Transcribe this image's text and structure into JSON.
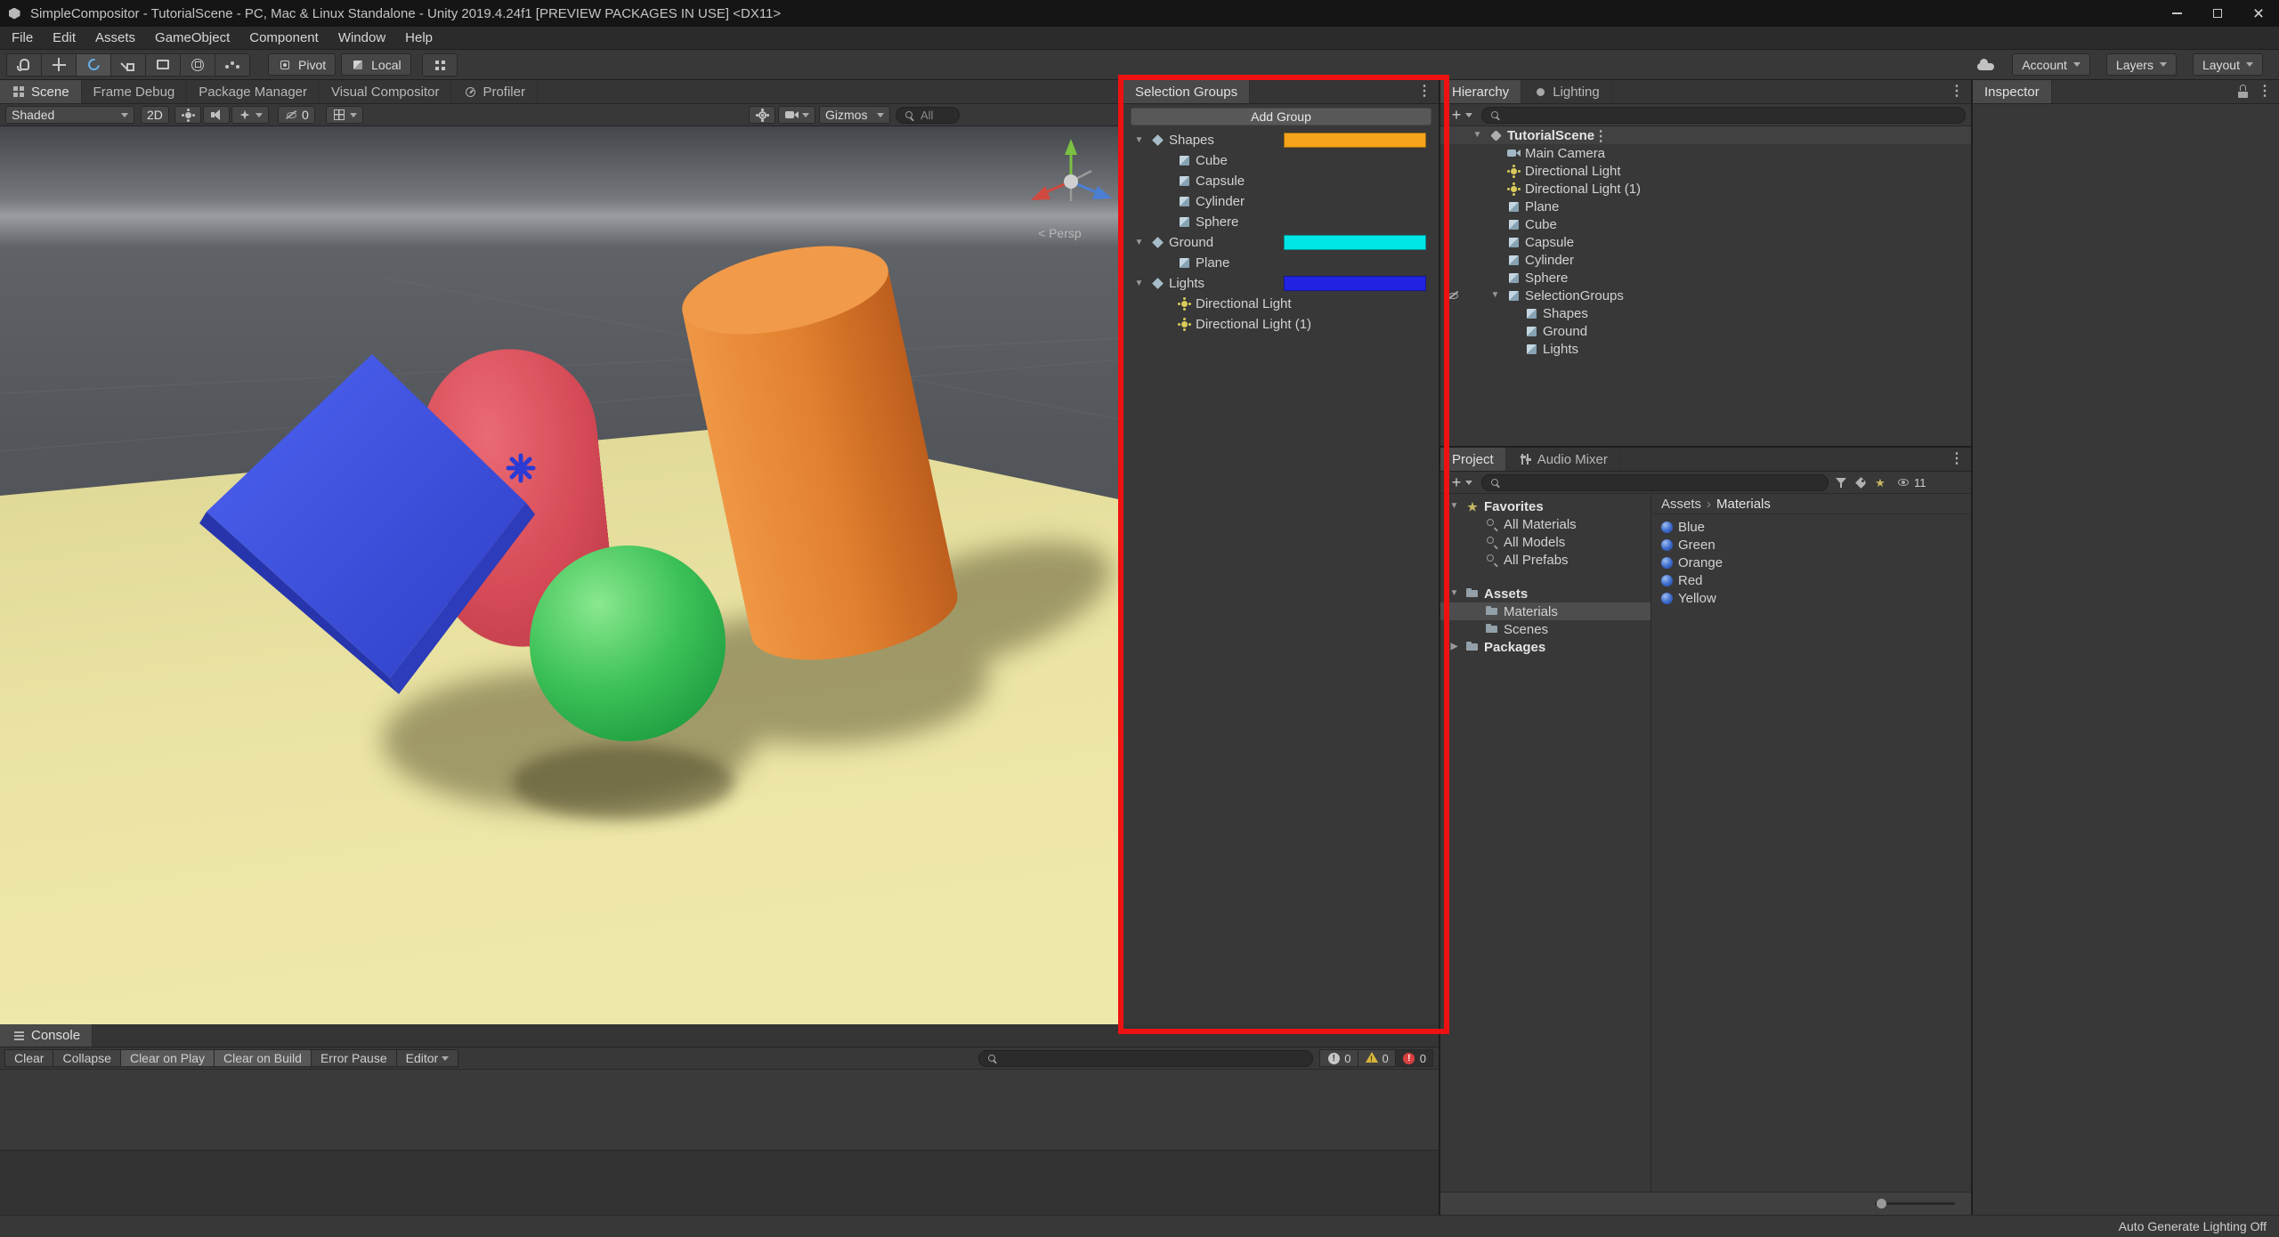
{
  "window": {
    "title": "SimpleCompositor - TutorialScene - PC, Mac & Linux Standalone - Unity 2019.4.24f1 [PREVIEW PACKAGES IN USE] <DX11>"
  },
  "menu": {
    "items": [
      "File",
      "Edit",
      "Assets",
      "GameObject",
      "Component",
      "Window",
      "Help"
    ]
  },
  "toolbar": {
    "tools": [
      {
        "icon": "hand-tool-icon"
      },
      {
        "icon": "move-tool-icon"
      },
      {
        "icon": "rotate-tool-icon",
        "active": true
      },
      {
        "icon": "scale-tool-icon"
      },
      {
        "icon": "rect-tool-icon"
      },
      {
        "icon": "transform-tool-icon"
      },
      {
        "icon": "custom-tool-icon"
      }
    ],
    "pivot": "Pivot",
    "local": "Local",
    "account": "Account",
    "layers": "Layers",
    "layout": "Layout"
  },
  "scene": {
    "tabs": [
      {
        "label": "Scene",
        "icon": "scene-tab-icon",
        "active": true
      },
      {
        "label": "Frame Debug"
      },
      {
        "label": "Package Manager"
      },
      {
        "label": "Visual Compositor"
      },
      {
        "label": "Profiler",
        "icon": "profiler-icon"
      }
    ],
    "controls": {
      "shaded": "Shaded",
      "two_d": "2D",
      "hidden_count": "0",
      "gizmos": "Gizmos",
      "search_placeholder": "All"
    },
    "persp_label": "< Persp"
  },
  "selection_groups": {
    "tab": "Selection Groups",
    "add_group_button": "Add Group",
    "rows": [
      {
        "label": "Shapes",
        "depth": 0,
        "icon": "unity-group-icon",
        "foldout": "▼",
        "swatch": "#f5a41b"
      },
      {
        "label": "Cube",
        "depth": 1,
        "icon": "cube-icon"
      },
      {
        "label": "Capsule",
        "depth": 1,
        "icon": "cube-icon"
      },
      {
        "label": "Cylinder",
        "depth": 1,
        "icon": "cube-icon"
      },
      {
        "label": "Sphere",
        "depth": 1,
        "icon": "cube-icon"
      },
      {
        "label": "Ground",
        "depth": 0,
        "icon": "unity-group-icon",
        "foldout": "▼",
        "swatch": "#00e6e6"
      },
      {
        "label": "Plane",
        "depth": 1,
        "icon": "cube-icon"
      },
      {
        "label": "Lights",
        "depth": 0,
        "icon": "unity-group-icon",
        "foldout": "▼",
        "swatch": "#2123e3"
      },
      {
        "label": "Directional Light",
        "depth": 1,
        "icon": "light-icon"
      },
      {
        "label": "Directional Light (1)",
        "depth": 1,
        "icon": "light-icon"
      }
    ]
  },
  "hierarchy": {
    "tab": "Hierarchy",
    "lighting_tab": "Lighting",
    "scene_name": "TutorialScene",
    "scene_foldout": "▼",
    "rows": [
      {
        "label": "Main Camera",
        "depth": 1,
        "icon": "camera-icon"
      },
      {
        "label": "Directional Light",
        "depth": 1,
        "icon": "light-icon"
      },
      {
        "label": "Directional Light (1)",
        "depth": 1,
        "icon": "light-icon"
      },
      {
        "label": "Plane",
        "depth": 1,
        "icon": "cube-icon"
      },
      {
        "label": "Cube",
        "depth": 1,
        "icon": "cube-icon"
      },
      {
        "label": "Capsule",
        "depth": 1,
        "icon": "cube-icon"
      },
      {
        "label": "Cylinder",
        "depth": 1,
        "icon": "cube-icon"
      },
      {
        "label": "Sphere",
        "depth": 1,
        "icon": "cube-icon"
      },
      {
        "label": "SelectionGroups",
        "depth": 1,
        "icon": "cube-icon",
        "foldout": "▼",
        "hidden": true
      },
      {
        "label": "Shapes",
        "depth": 2,
        "icon": "cube-icon"
      },
      {
        "label": "Ground",
        "depth": 2,
        "icon": "cube-icon"
      },
      {
        "label": "Lights",
        "depth": 2,
        "icon": "cube-icon"
      }
    ]
  },
  "project": {
    "tab": "Project",
    "audio_mixer_tab": "Audio Mixer",
    "hidden_packages_count": "11",
    "folders": [
      {
        "label": "Favorites",
        "depth": 0,
        "icon": "star-icon",
        "foldout": "▼",
        "bold": true
      },
      {
        "label": "All Materials",
        "depth": 1,
        "icon": "search-icon"
      },
      {
        "label": "All Models",
        "depth": 1,
        "icon": "search-icon"
      },
      {
        "label": "All Prefabs",
        "depth": 1,
        "icon": "search-icon"
      },
      {
        "label": "Assets",
        "depth": 0,
        "icon": "folder-icon",
        "foldout": "▼",
        "bold": true,
        "gap": true
      },
      {
        "label": "Materials",
        "depth": 1,
        "icon": "folder-icon",
        "selected": true
      },
      {
        "label": "Scenes",
        "depth": 1,
        "icon": "folder-icon"
      },
      {
        "label": "Packages",
        "depth": 0,
        "icon": "folder-icon",
        "foldout": "▶",
        "bold": true
      }
    ],
    "breadcrumb": {
      "root": "Assets",
      "separator": "›",
      "current": "Materials"
    },
    "files": [
      {
        "label": "Blue",
        "icon": "material-icon"
      },
      {
        "label": "Green",
        "icon": "material-icon"
      },
      {
        "label": "Orange",
        "icon": "material-icon"
      },
      {
        "label": "Red",
        "icon": "material-icon"
      },
      {
        "label": "Yellow",
        "icon": "material-icon"
      }
    ]
  },
  "inspector": {
    "tab": "Inspector"
  },
  "console": {
    "tab": "Console",
    "buttons": [
      {
        "label": "Clear"
      },
      {
        "label": "Collapse"
      },
      {
        "label": "Clear on Play",
        "pressed": true
      },
      {
        "label": "Clear on Build",
        "pressed": true
      },
      {
        "label": "Error Pause"
      },
      {
        "label": "Editor",
        "dropdown": true
      }
    ],
    "counts": {
      "info": "0",
      "warnings": "0",
      "errors": "0"
    }
  },
  "status_bar": {
    "lighting": "Auto Generate Lighting Off"
  }
}
